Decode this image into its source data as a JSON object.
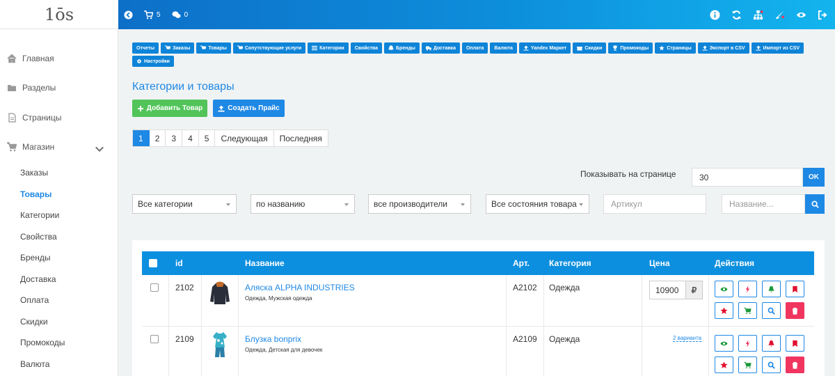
{
  "logo": {
    "text": "1ōs"
  },
  "topbar": {
    "cart_count": "5",
    "messages_count": "0"
  },
  "sidebar": {
    "items": [
      {
        "label": "Главная",
        "icon": "home-icon"
      },
      {
        "label": "Разделы",
        "icon": "folder-icon"
      },
      {
        "label": "Страницы",
        "icon": "file-icon"
      },
      {
        "label": "Магазин",
        "icon": "cart-icon"
      }
    ],
    "shop_items": [
      "Заказы",
      "Товары",
      "Категории",
      "Свойства",
      "Бренды",
      "Доставка",
      "Оплата",
      "Скидки",
      "Промокоды",
      "Валюта"
    ],
    "active": "Товары"
  },
  "nav": [
    {
      "label": "Отчеты",
      "icon": ""
    },
    {
      "label": "Заказы",
      "icon": "cart-icon"
    },
    {
      "label": "Товары",
      "icon": "cart-icon"
    },
    {
      "label": "Сопутствующие услуги",
      "icon": "cart-icon"
    },
    {
      "label": "Категории",
      "icon": "list-icon"
    },
    {
      "label": "Свойства",
      "icon": ""
    },
    {
      "label": "Бренды",
      "icon": "bell-icon"
    },
    {
      "label": "Доставка",
      "icon": "truck-icon"
    },
    {
      "label": "Оплата",
      "icon": ""
    },
    {
      "label": "Валюта",
      "icon": ""
    },
    {
      "label": "Yandex Маркет",
      "icon": "upload-icon"
    },
    {
      "label": "Скидки",
      "icon": "gift-icon"
    },
    {
      "label": "Промокоды",
      "icon": "trophy-icon"
    },
    {
      "label": "Страницы",
      "icon": "star-icon"
    },
    {
      "label": "Экспорт в CSV",
      "icon": "upload-icon"
    },
    {
      "label": "Импорт из CSV",
      "icon": "upload-icon"
    },
    {
      "label": "Настройки",
      "icon": "gear-icon"
    }
  ],
  "page": {
    "title": "Категории и товары",
    "add_button": "Добавить Товар",
    "price_button": "Создать Прайс"
  },
  "pagination": {
    "pages": [
      "1",
      "2",
      "3",
      "4",
      "5"
    ],
    "current": "1",
    "next": "Следующая",
    "last": "Последняя"
  },
  "per_page": {
    "label": "Показывать на странице",
    "value": "30",
    "ok": "OK"
  },
  "filters": {
    "category": "Все категории",
    "sort": "по названию",
    "brand": "все производители",
    "state": "Все состояния товара",
    "article_placeholder": "Артикул",
    "name_placeholder": "Название..."
  },
  "table": {
    "headers": {
      "id": "id",
      "name": "Название",
      "art": "Арт.",
      "category": "Категория",
      "price": "Цена",
      "actions": "Действия"
    },
    "rows": [
      {
        "id": "2102",
        "name": "Аляска ALPHA INDUSTRIES",
        "subcat": "Одежда, Мужская одежда",
        "art": "A2102",
        "category": "Одежда",
        "price": "10900",
        "currency": "₽",
        "variants": ""
      },
      {
        "id": "2109",
        "name": "Блузка bonprix",
        "subcat": "Одежда, Детская для девочек",
        "art": "A2109",
        "category": "Одежда",
        "price": "",
        "currency": "",
        "variants": "2 варианта"
      }
    ]
  },
  "colors": {
    "accent": "#1e88e5",
    "success": "#52c45a",
    "danger": "#f0355f",
    "topbar": "#0d8fdc"
  }
}
